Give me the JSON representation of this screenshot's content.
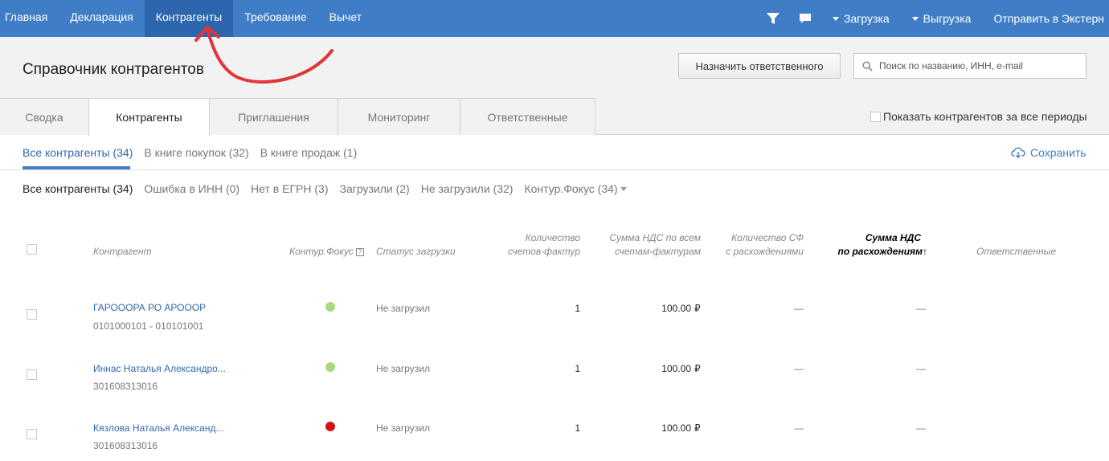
{
  "nav": {
    "items": [
      "Главная",
      "Декларация",
      "Контрагенты",
      "Требование",
      "Вычет"
    ],
    "active_index": 2,
    "right": {
      "filter_icon": "filter-icon",
      "chat_icon": "chat-icon",
      "upload": "Загрузка",
      "download": "Выгрузка",
      "send": "Отправить в Экстерн"
    }
  },
  "header": {
    "title": "Справочник контрагентов",
    "assign_button": "Назначить ответственного",
    "search_placeholder": "Поиск по названию, ИНН, e-mail"
  },
  "tabs": [
    "Сводка",
    "Контрагенты",
    "Приглашения",
    "Мониторинг",
    "Ответственные"
  ],
  "active_tab": 1,
  "show_all_periods": {
    "label": "Показать контрагентов за все периоды",
    "checked": false
  },
  "subfilters": [
    "Все контрагенты (34)",
    "В книге покупок (32)",
    "В книге продаж (1)"
  ],
  "save_label": "Сохранить",
  "filters2": [
    "Все контрагенты (34)",
    "Ошибка в ИНН (0)",
    "Нет в ЕГРН (3)",
    "Загрузили (2)",
    "Не загрузили (32)",
    "Контур.Фокус (34)"
  ],
  "table": {
    "headers": {
      "counterparty": "Контрагент",
      "focus": "Контур.Фокус",
      "status": "Статус загрузки",
      "invoices_count_1": "Количество",
      "invoices_count_2": "счетов-фактур",
      "vat_sum_1": "Сумма НДС по всем",
      "vat_sum_2": "счетам-фактурам",
      "discrepancy_count_1": "Количество СФ",
      "discrepancy_count_2": "с расхождениями",
      "vat_discrepancy_1": "Сумма НДС",
      "vat_discrepancy_2": "по расхождениям",
      "sort_arrow": "↑",
      "responsible": "Ответственные",
      "help": "?"
    },
    "rows": [
      {
        "name": "ГАРОООРА РО АРОООР",
        "inn": "0101000101 - 010101001",
        "focus_color": "#a9d97a",
        "status": "Не загрузил",
        "count": "1",
        "sum": "100.00",
        "currency": "₽",
        "disc_count": "—",
        "disc_sum": "—"
      },
      {
        "name": "Иннас Наталья Александро...",
        "inn": "301608313016",
        "focus_color": "#a9d97a",
        "status": "Не загрузил",
        "count": "1",
        "sum": "100.00",
        "currency": "₽",
        "disc_count": "—",
        "disc_sum": "—"
      },
      {
        "name": "Кязлова Наталья Александ...",
        "inn": "301608313016",
        "focus_color": "#d0121b",
        "status": "Не загрузил",
        "count": "1",
        "sum": "100.00",
        "currency": "₽",
        "disc_count": "—",
        "disc_sum": "—"
      }
    ]
  },
  "colors": {
    "nav_bg": "#3f7ec7",
    "nav_active": "#2d66ad",
    "link": "#3168b0",
    "annotation_arrow": "#e0363b"
  }
}
